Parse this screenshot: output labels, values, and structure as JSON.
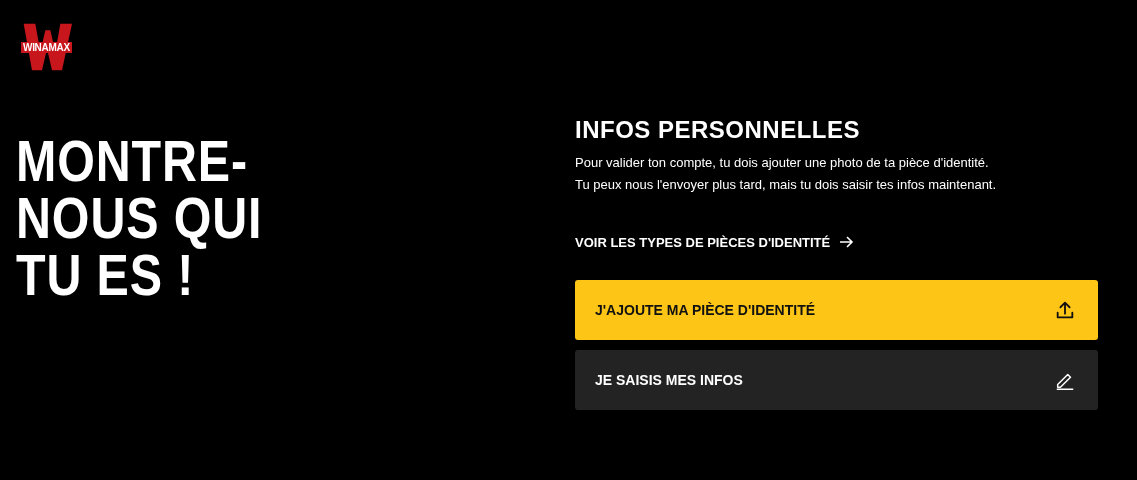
{
  "logo": {
    "text": "WINAMAX"
  },
  "headline": {
    "lines": [
      "MONTRE-",
      "NOUS QUI",
      "TU ES !"
    ]
  },
  "section": {
    "title": "INFOS PERSONNELLES",
    "description": [
      "Pour valider ton compte, tu dois ajouter une photo de ta pièce d'identité.",
      "Tu peux nous l'envoyer plus tard, mais tu dois saisir tes infos maintenant."
    ],
    "link": "VOIR LES TYPES DE PIÈCES D'IDENTITÉ"
  },
  "actions": [
    {
      "label": "J'AJOUTE MA PIÈCE D'IDENTITÉ",
      "kind": "upload"
    },
    {
      "label": "JE SAISIS MES INFOS",
      "kind": "edit"
    }
  ]
}
